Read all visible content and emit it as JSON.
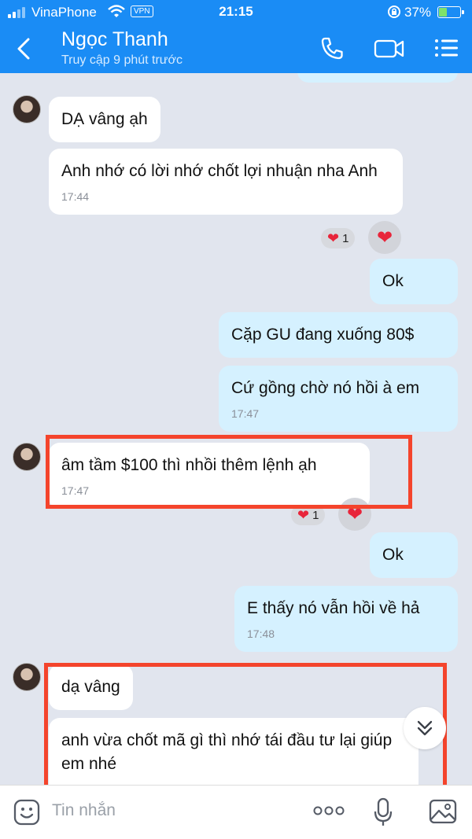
{
  "status_bar": {
    "carrier": "VinaPhone",
    "vpn": "VPN",
    "time": "21:15",
    "battery": "37%",
    "battery_level": 0.37,
    "icons": [
      "signal-icon",
      "wifi-icon",
      "rotation-lock-icon",
      "battery-icon"
    ]
  },
  "header": {
    "name": "Ngọc Thanh",
    "status": "Truy cập 9 phút trước",
    "icons": [
      "back-icon",
      "phone-icon",
      "video-call-icon",
      "menu-icon"
    ]
  },
  "messages": [
    {
      "dir": "in",
      "text": "DẠ vâng ạh",
      "time": ""
    },
    {
      "dir": "in",
      "text": "Anh nhớ có lời nhớ chốt lợi nhuận nha Anh",
      "time": "17:44",
      "reaction_count": "1"
    },
    {
      "dir": "out",
      "text": "Ok",
      "time": ""
    },
    {
      "dir": "out",
      "text": "Cặp GU đang xuống 80$",
      "time": ""
    },
    {
      "dir": "out",
      "text": "Cứ gồng chờ nó hồi à em",
      "time": "17:47"
    },
    {
      "dir": "in",
      "text": "âm tầm $100 thì nhồi thêm lệnh ạh",
      "time": "17:47",
      "reaction_count": "1"
    },
    {
      "dir": "out",
      "text": "Ok",
      "time": ""
    },
    {
      "dir": "out",
      "text": "E thấy nó vẫn hồi về hả",
      "time": "17:48"
    },
    {
      "dir": "in",
      "text": "dạ vâng",
      "time": ""
    },
    {
      "dir": "in",
      "text": "anh vừa chốt mã gì thì nhớ tái đầu tư lại giúp em nhé",
      "time": ""
    }
  ],
  "input": {
    "placeholder": "Tin nhắn",
    "icons": [
      "sticker-icon",
      "more-icon",
      "microphone-icon",
      "image-icon"
    ]
  },
  "colors": {
    "header": "#1a8cf5",
    "chat_bg": "#e1e5ee",
    "incoming": "#ffffff",
    "outgoing": "#d5f1ff",
    "highlight": "#f4442c",
    "heart": "#e8253a"
  }
}
